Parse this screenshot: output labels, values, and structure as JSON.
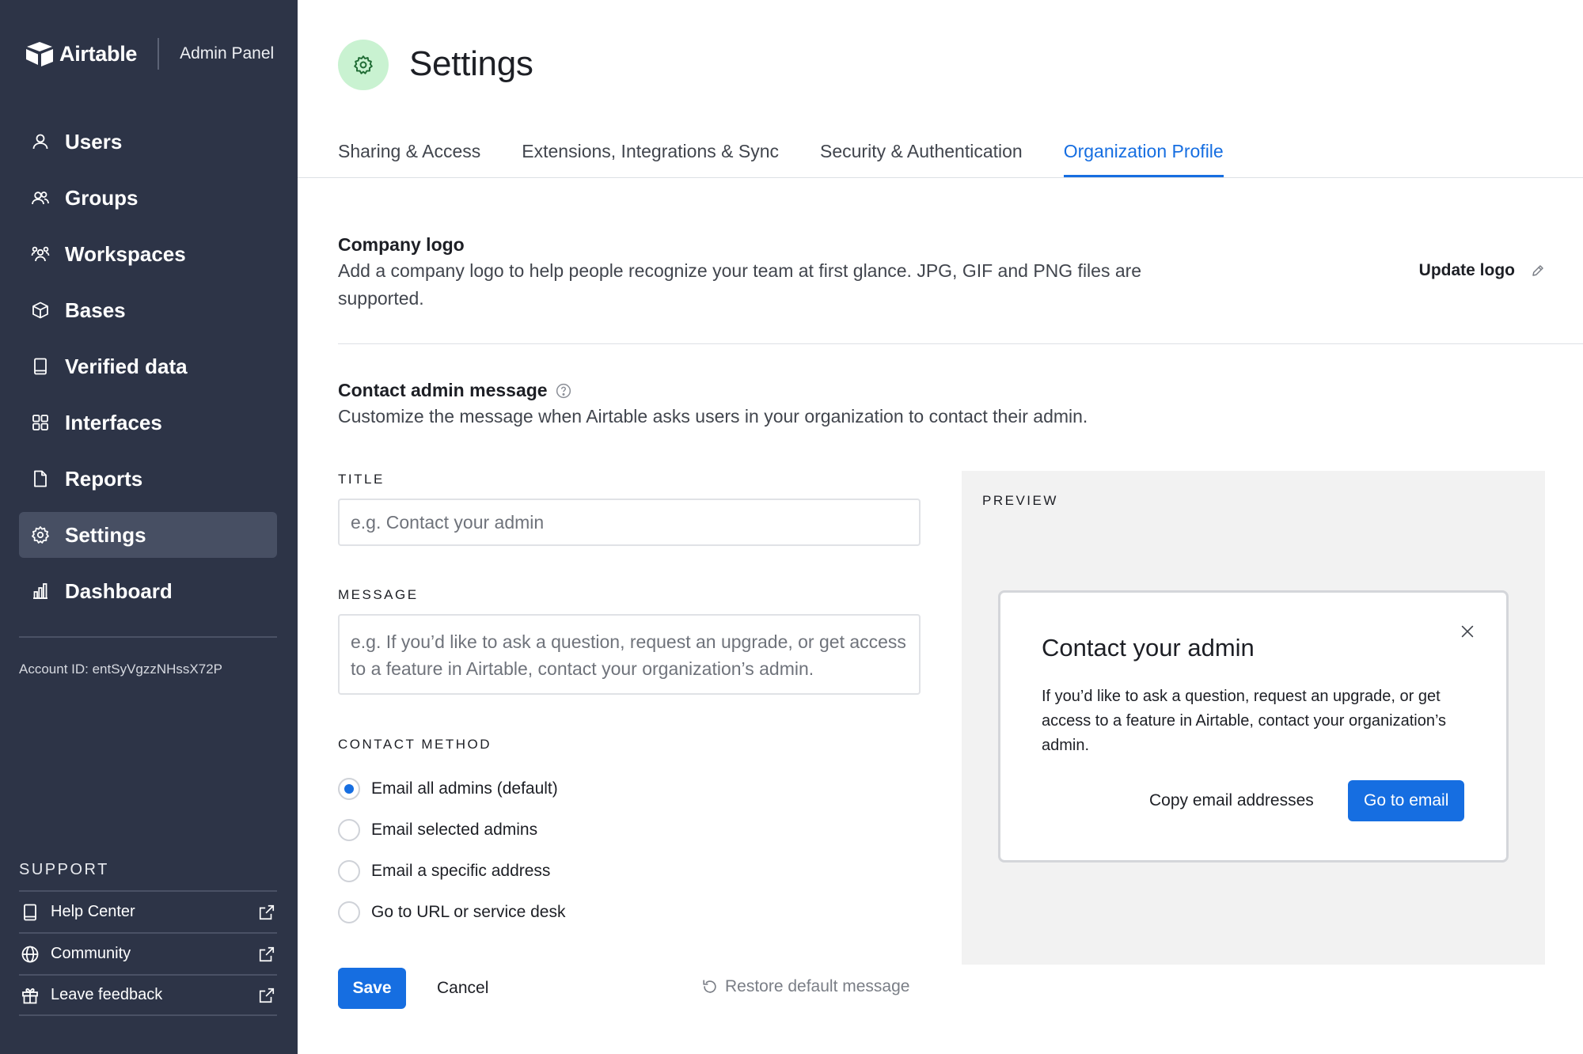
{
  "sidebar": {
    "brand_name": "Airtable",
    "brand_sub": "Admin Panel",
    "nav": [
      {
        "label": "Users",
        "icon": "user-icon"
      },
      {
        "label": "Groups",
        "icon": "users-icon"
      },
      {
        "label": "Workspaces",
        "icon": "team-icon"
      },
      {
        "label": "Bases",
        "icon": "cube-icon"
      },
      {
        "label": "Verified data",
        "icon": "book-icon"
      },
      {
        "label": "Interfaces",
        "icon": "grid-icon"
      },
      {
        "label": "Reports",
        "icon": "file-icon"
      },
      {
        "label": "Settings",
        "icon": "gear-icon",
        "active": true
      },
      {
        "label": "Dashboard",
        "icon": "bar-chart-icon"
      }
    ],
    "account_id": "Account ID: entSyVgzzNHssX72P",
    "support_title": "SUPPORT",
    "support": [
      {
        "label": "Help Center",
        "icon": "book-icon"
      },
      {
        "label": "Community",
        "icon": "globe-icon"
      },
      {
        "label": "Leave feedback",
        "icon": "gift-icon"
      }
    ]
  },
  "header": {
    "title": "Settings",
    "icon": "gear-icon",
    "icon_bg": "#c9f2d1"
  },
  "tabs": [
    {
      "label": "Sharing & Access"
    },
    {
      "label": "Extensions, Integrations & Sync"
    },
    {
      "label": "Security & Authentication"
    },
    {
      "label": "Organization Profile",
      "active": true
    }
  ],
  "logo_section": {
    "title": "Company logo",
    "description": "Add a company logo to help people recognize your team at first glance. JPG, GIF and PNG files are supported.",
    "update_label": "Update logo"
  },
  "contact_section": {
    "title": "Contact admin message",
    "description": "Customize the message when Airtable asks users in your organization to contact their admin.",
    "title_label": "TITLE",
    "title_value": "",
    "title_placeholder": "e.g. Contact your admin",
    "message_label": "MESSAGE",
    "message_value": "",
    "message_placeholder": "e.g. If you’d like to ask a question, request an upgrade, or get access to a feature in Airtable, contact your organization’s admin.",
    "method_label": "CONTACT METHOD",
    "methods": [
      {
        "label": "Email all admins (default)",
        "checked": true
      },
      {
        "label": "Email selected admins",
        "checked": false
      },
      {
        "label": "Email a specific address",
        "checked": false
      },
      {
        "label": "Go to URL or service desk",
        "checked": false
      }
    ]
  },
  "actions": {
    "save": "Save",
    "cancel": "Cancel",
    "restore": "Restore default message"
  },
  "preview": {
    "label": "PREVIEW",
    "modal_title": "Contact your admin",
    "modal_body": "If you’d like to ask a question, request an upgrade, or get access to a feature in Airtable, contact your organization’s admin.",
    "copy_label": "Copy email addresses",
    "go_label": "Go to email"
  },
  "colors": {
    "sidebar_bg": "#2d3447",
    "accent": "#166ee1",
    "preview_bg": "#f2f2f2"
  }
}
